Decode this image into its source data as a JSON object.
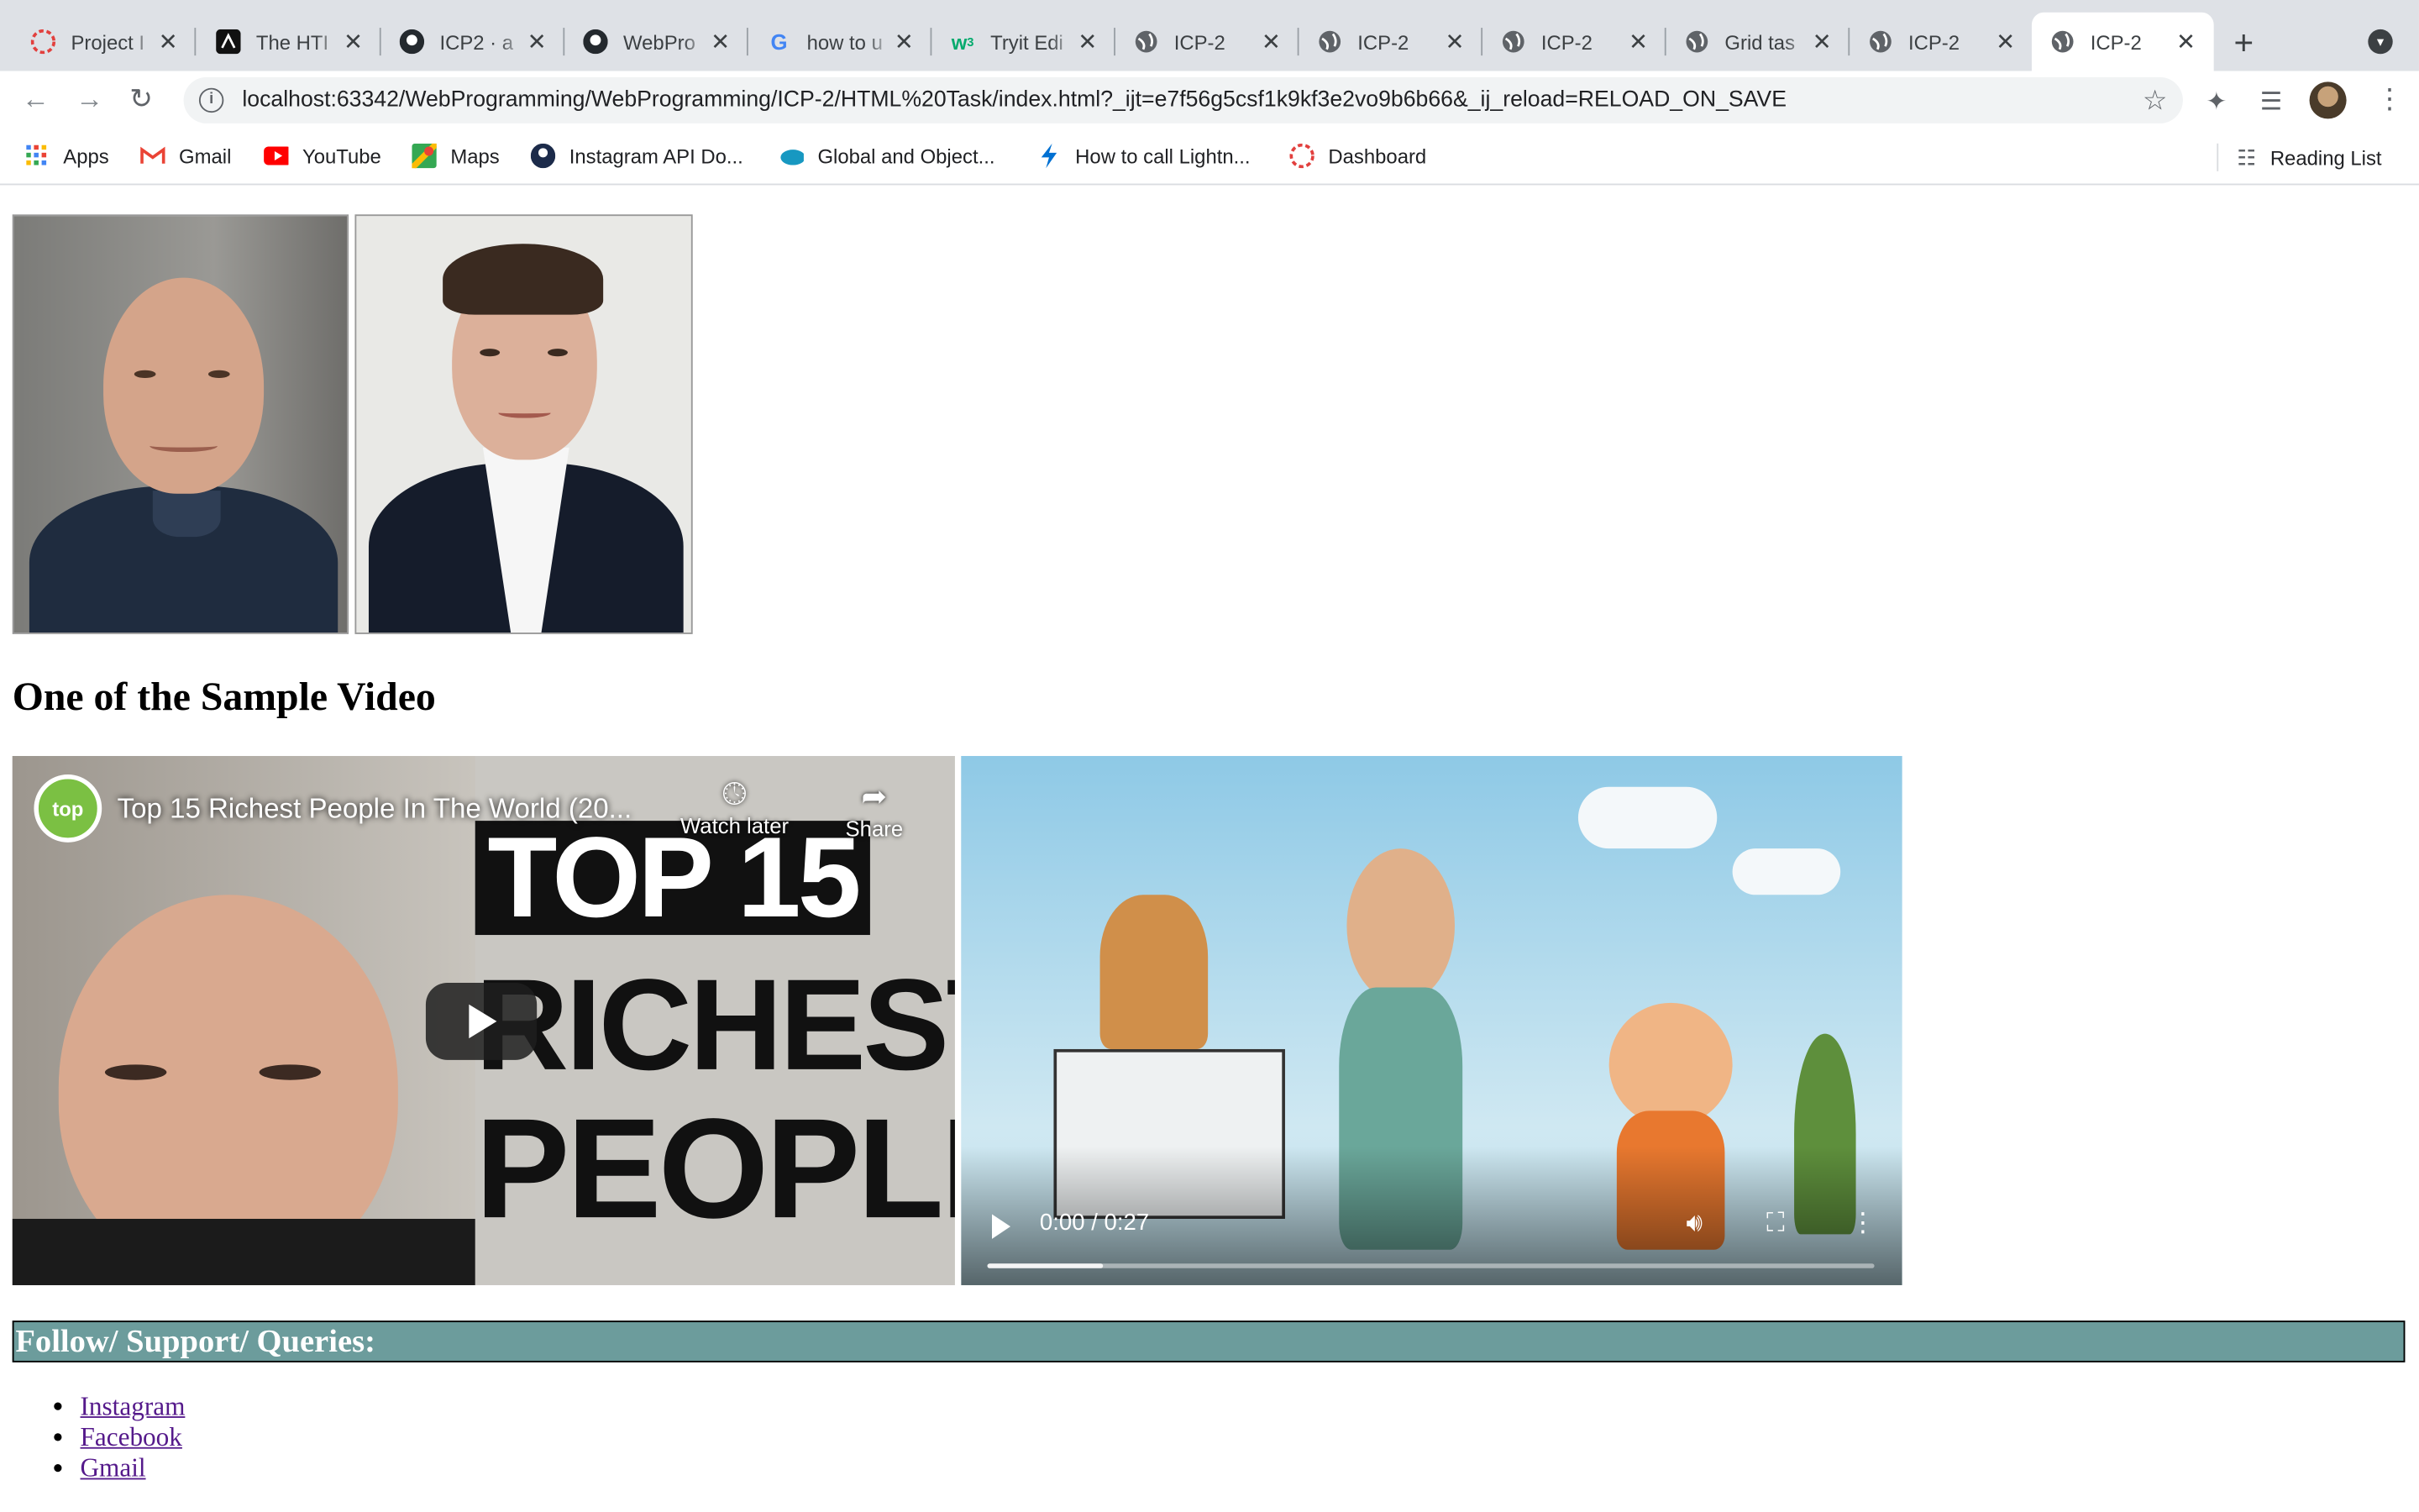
{
  "browser": {
    "tabs": [
      {
        "title": "Project I",
        "icon": "salesforce-icon",
        "active": false
      },
      {
        "title": "The HTI",
        "icon": "dev-icon",
        "active": false
      },
      {
        "title": "ICP2 · a",
        "icon": "github-icon",
        "active": false
      },
      {
        "title": "WebPro",
        "icon": "github-icon",
        "active": false
      },
      {
        "title": "how to u",
        "icon": "google-icon",
        "active": false
      },
      {
        "title": "Tryit Edi",
        "icon": "w3schools-icon",
        "active": false
      },
      {
        "title": "ICP-2",
        "icon": "globe-icon",
        "active": false
      },
      {
        "title": "ICP-2",
        "icon": "globe-icon",
        "active": false
      },
      {
        "title": "ICP-2",
        "icon": "globe-icon",
        "active": false
      },
      {
        "title": "Grid tas",
        "icon": "globe-icon",
        "active": false
      },
      {
        "title": "ICP-2",
        "icon": "globe-icon",
        "active": false
      },
      {
        "title": "ICP-2",
        "icon": "globe-icon",
        "active": true
      }
    ],
    "url": "localhost:63342/WebProgramming/WebProgramming/ICP-2/HTML%20Task/index.html?_ijt=e7f56g5csf1k9kf3e2vo9b6b66&_ij_reload=RELOAD_ON_SAVE",
    "bookmarks": [
      {
        "label": "Apps",
        "icon": "apps-grid-icon"
      },
      {
        "label": "Gmail",
        "icon": "gmail-icon"
      },
      {
        "label": "YouTube",
        "icon": "youtube-icon"
      },
      {
        "label": "Maps",
        "icon": "maps-icon"
      },
      {
        "label": "Instagram API Do...",
        "icon": "instagram-icon"
      },
      {
        "label": "Global and Object...",
        "icon": "cloud-icon"
      },
      {
        "label": "How to call Lightn...",
        "icon": "lightning-icon"
      },
      {
        "label": "Dashboard",
        "icon": "salesforce-icon"
      }
    ],
    "reading_list": "Reading List"
  },
  "page": {
    "video_heading": "One of the Sample Video",
    "youtube": {
      "title": "Top 15 Richest People In The World (20...",
      "channel_logo": "top",
      "watch_later": "Watch later",
      "share": "Share",
      "thumb_line1": "TOP 15",
      "thumb_line2": "RICHEST",
      "thumb_line3": "PEOPLE"
    },
    "video_player": {
      "time": "0:00 / 0:27",
      "progress": 0.13
    },
    "follow_heading": "Follow/ Support/ Queries:",
    "links": [
      "Instagram",
      "Facebook",
      "Gmail"
    ]
  },
  "colors": {
    "follow_bg": "#6c9c9c",
    "link": "#551a8b"
  }
}
